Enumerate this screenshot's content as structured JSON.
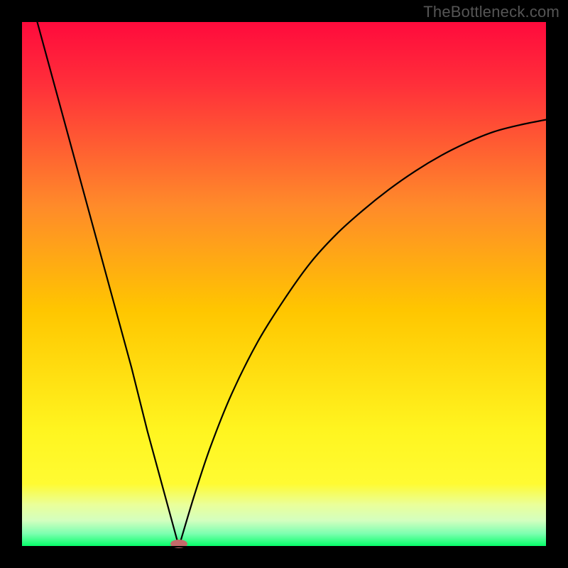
{
  "watermark": "TheBottleneck.com",
  "chart_data": {
    "type": "line",
    "title": "",
    "xlabel": "",
    "ylabel": "",
    "xlim": [
      0,
      100
    ],
    "ylim": [
      0,
      100
    ],
    "background_gradient": {
      "top_color": "#ff0a3c",
      "mid_color": "#ffc600",
      "lower_color": "#fffb32",
      "pale_band": "#d4ffbf",
      "bottom_color": "#00ff66"
    },
    "frame_color": "#000000",
    "curve_color": "#000000",
    "minimum_x": 30,
    "marker": {
      "x": 30,
      "y": 0,
      "color": "#c46a6a",
      "shape": "ellipse"
    },
    "series": [
      {
        "name": "bottleneck-curve",
        "description": "Asymmetric V-shaped curve touching zero at x≈30; left branch near-linear steep descent from (3,100) to (30,0); right branch rises with decreasing slope toward (100,~81).",
        "x": [
          3,
          6,
          9,
          12,
          15,
          18,
          21,
          24,
          27,
          30,
          33,
          36,
          40,
          45,
          50,
          55,
          60,
          65,
          70,
          75,
          80,
          85,
          90,
          95,
          100
        ],
        "y": [
          100,
          89,
          78,
          67,
          56,
          45,
          34,
          22,
          11,
          0,
          10,
          19,
          29,
          39,
          47,
          54,
          59.5,
          64,
          68,
          71.5,
          74.5,
          77,
          79,
          80.3,
          81.3
        ]
      }
    ]
  }
}
